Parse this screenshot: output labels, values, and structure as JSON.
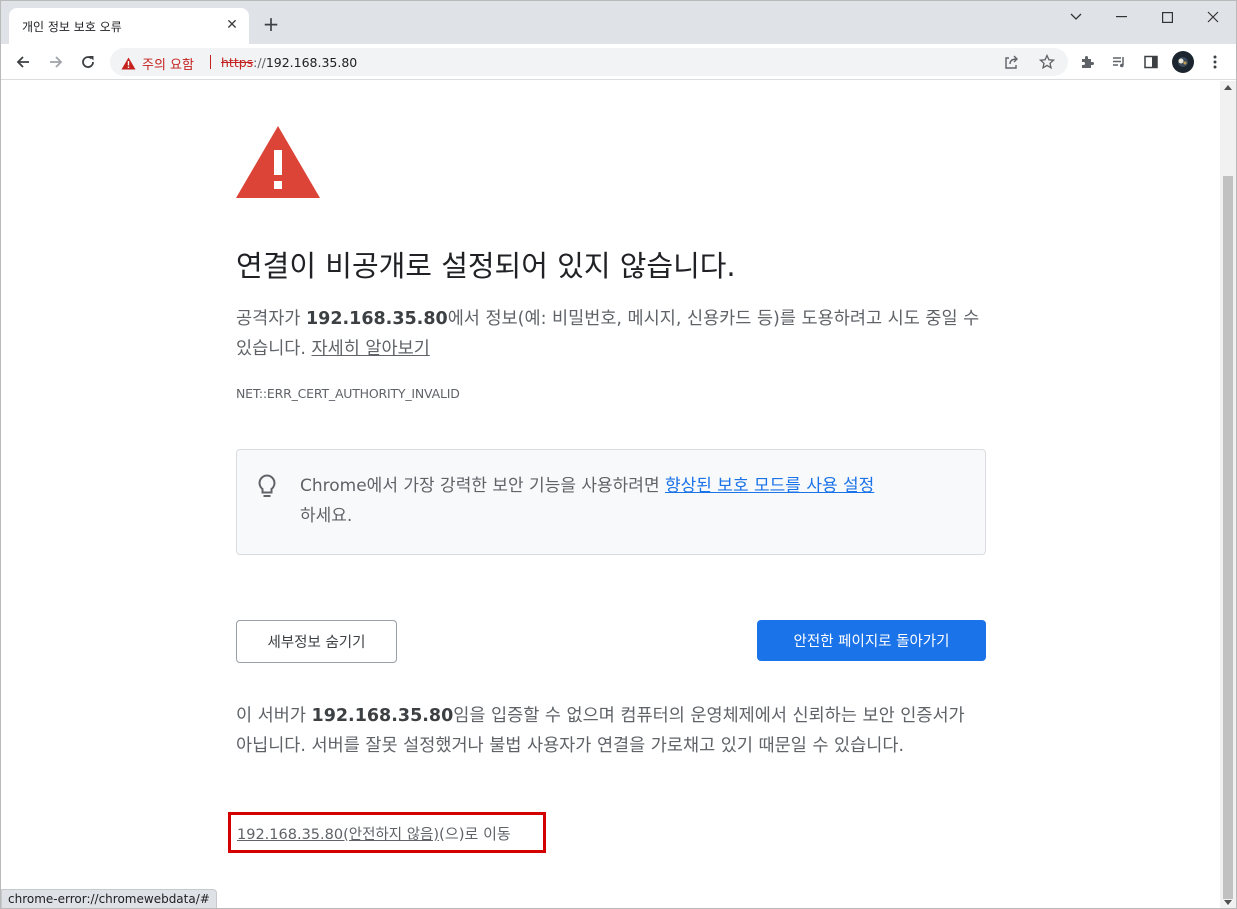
{
  "tab": {
    "title": "개인 정보 보호 오류",
    "close": "✕",
    "new_tab": "+"
  },
  "omnibox": {
    "security_label": "주의 요함",
    "url_scheme": "https",
    "url_separator": "://",
    "url_host": "192.168.35.80"
  },
  "page": {
    "heading": "연결이 비공개로 설정되어 있지 않습니다.",
    "explanation_before": "공격자가 ",
    "explanation_host": "192.168.35.80",
    "explanation_after": "에서 정보(예: 비밀번호, 메시지, 신용카드 등)를 도용하려고 시도 중일 수 있습니다. ",
    "learn_more": "자세히 알아보기",
    "error_code": "NET::ERR_CERT_AUTHORITY_INVALID",
    "enhanced_before": "Chrome에서 가장 강력한 보안 기능을 사용하려면 ",
    "enhanced_link": "향상된 보호 모드를 사용 설정",
    "enhanced_after": "하세요.",
    "details_button": "세부정보 숨기기",
    "back_button": "안전한 페이지로 돌아가기",
    "final_before": "이 서버가 ",
    "final_host": "192.168.35.80",
    "final_after": "임을 입증할 수 없으며 컴퓨터의 운영체제에서 신뢰하는 보안 인증서가 아닙니다. 서버를 잘못 설정했거나 불법 사용자가 연결을 가로채고 있기 때문일 수 있습니다.",
    "proceed_link": "192.168.35.80(안전하지 않음)",
    "proceed_suffix": "(으)로 이동"
  },
  "status_bar": "chrome-error://chromewebdata/#",
  "colors": {
    "warning_red": "#d93025",
    "link_blue": "#1a73e8",
    "primary_button": "#1a73e8",
    "highlight_border": "#d40000"
  },
  "icons": [
    "back-icon",
    "forward-icon",
    "reload-icon",
    "warning-icon",
    "share-icon",
    "star-icon",
    "extensions-icon",
    "media-icon",
    "side-panel-icon",
    "avatar",
    "menu-icon",
    "lightbulb-icon",
    "big-warning-icon",
    "minimize-icon",
    "maximize-icon",
    "close-icon",
    "tab-search-icon"
  ]
}
